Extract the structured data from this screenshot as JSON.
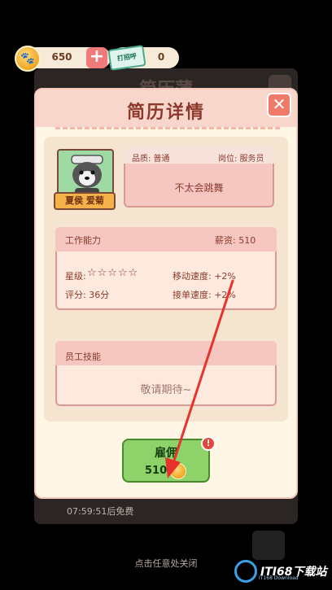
{
  "currency": {
    "coins": "650",
    "tickets": "0",
    "ticket_icon_text": "打招呼"
  },
  "background": {
    "title": "简历薄",
    "timer": "07:59:51后免费",
    "tap_to_close": "点击任意处关闭"
  },
  "modal": {
    "title": "简历详情",
    "employee": {
      "name": "夏侯 爱菊",
      "quality": "品质: 普通",
      "position": "岗位: 服务员",
      "description": "不太会跳舞"
    },
    "ability": {
      "title": "工作能力",
      "salary": "薪资: 510",
      "star_label": "星级:",
      "stars": "☆☆☆☆☆",
      "score": "评分: 36分",
      "move_speed": "移动速度: +2%",
      "order_speed": "接单速度: +2%"
    },
    "skills": {
      "title": "员工技能",
      "empty_text": "敬请期待~"
    },
    "hire": {
      "label": "雇佣",
      "cost": "510",
      "alert": "!"
    }
  },
  "watermark": {
    "text": "ITI68下载站",
    "sub": "IT168 Download"
  },
  "colors": {
    "accent_red": "#f07a6a",
    "hire_green": "#8ed36a",
    "arrow": "#e8332c"
  }
}
